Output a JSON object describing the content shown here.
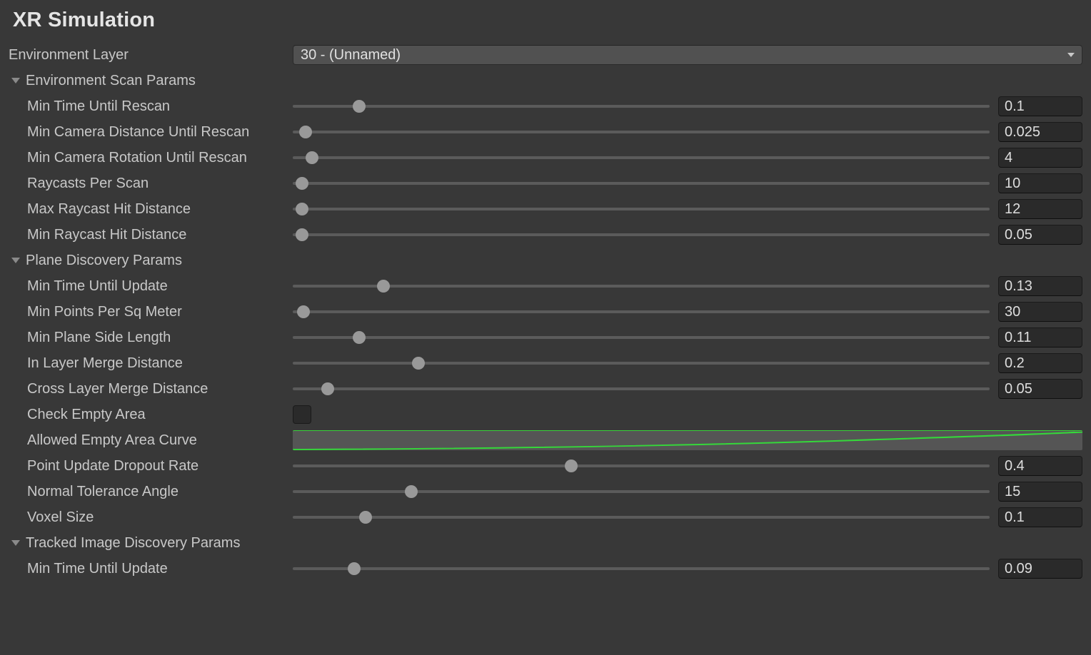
{
  "title": "XR Simulation",
  "environmentLayer": {
    "label": "Environment Layer",
    "value": "30 - (Unnamed)"
  },
  "sections": {
    "scan": {
      "heading": "Environment Scan Params",
      "expanded": true,
      "items": {
        "minTimeRescan": {
          "label": "Min Time Until Rescan",
          "value": "0.1",
          "pos": 0.095
        },
        "minCamDist": {
          "label": "Min Camera Distance Until Rescan",
          "value": "0.025",
          "pos": 0.018
        },
        "minCamRot": {
          "label": "Min Camera Rotation Until Rescan",
          "value": "4",
          "pos": 0.028
        },
        "raycastsPerScan": {
          "label": "Raycasts Per Scan",
          "value": "10",
          "pos": 0.013
        },
        "maxHitDist": {
          "label": "Max Raycast Hit Distance",
          "value": "12",
          "pos": 0.013
        },
        "minHitDist": {
          "label": "Min Raycast Hit Distance",
          "value": "0.05",
          "pos": 0.013
        }
      }
    },
    "plane": {
      "heading": "Plane Discovery Params",
      "expanded": true,
      "items": {
        "minTimeUpdate": {
          "label": "Min Time Until Update",
          "value": "0.13",
          "pos": 0.13
        },
        "minPtsSq": {
          "label": "Min Points Per Sq Meter",
          "value": "30",
          "pos": 0.015
        },
        "minPlaneSide": {
          "label": "Min Plane Side Length",
          "value": "0.11",
          "pos": 0.095
        },
        "inLayerMerge": {
          "label": "In Layer Merge Distance",
          "value": "0.2",
          "pos": 0.18
        },
        "crossLayerMerge": {
          "label": "Cross Layer Merge Distance",
          "value": "0.05",
          "pos": 0.05
        },
        "checkEmpty": {
          "label": "Check Empty Area",
          "checked": false
        },
        "emptyCurve": {
          "label": "Allowed Empty Area Curve"
        },
        "dropoutRate": {
          "label": "Point Update Dropout Rate",
          "value": "0.4",
          "pos": 0.4
        },
        "normalTol": {
          "label": "Normal Tolerance Angle",
          "value": "15",
          "pos": 0.17
        },
        "voxelSize": {
          "label": "Voxel Size",
          "value": "0.1",
          "pos": 0.105
        }
      }
    },
    "tracked": {
      "heading": "Tracked Image Discovery Params",
      "expanded": true,
      "items": {
        "minTimeUpdate": {
          "label": "Min Time Until Update",
          "value": "0.09",
          "pos": 0.088
        }
      }
    }
  }
}
